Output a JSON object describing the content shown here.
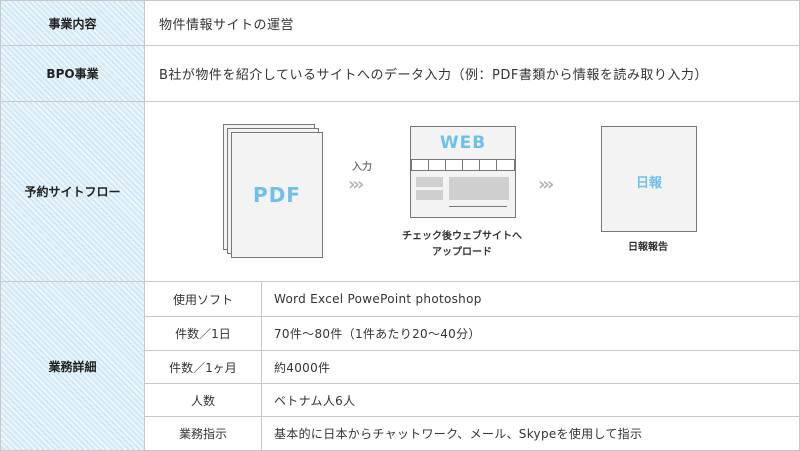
{
  "rows": {
    "business": {
      "label": "事業内容",
      "value": "物件情報サイトの運営"
    },
    "bpo": {
      "label": "BPO事業",
      "value": "B社が物件を紹介しているサイトへのデータ入力（例：PDF書類から情報を読み取り入力）"
    },
    "flow": {
      "label": "予約サイトフロー",
      "pdf": "PDF",
      "arrow_label": "入力",
      "chevrons": "›››",
      "web": "WEB",
      "web_caption_1": "チェック後ウェブサイトへ",
      "web_caption_2": "アップロード",
      "report": "日報",
      "report_caption": "日報報告"
    },
    "details": {
      "label": "業務詳細",
      "items": [
        {
          "label": "使用ソフト",
          "value": "Word Excel  PowePoint  photoshop"
        },
        {
          "label": "件数／1日",
          "value": "70件～80件（1件あたり20～40分）"
        },
        {
          "label": "件数／1ヶ月",
          "value": "約4000件"
        },
        {
          "label": "人数",
          "value": "ベトナム人6人"
        },
        {
          "label": "業務指示",
          "value": "基本的に日本からチャットワーク、メール、Skypeを使用して指示"
        }
      ]
    }
  },
  "colors": {
    "accent": "#6ec0ec",
    "header_bg": "#d4ebf7",
    "border": "#c8c8c8"
  }
}
